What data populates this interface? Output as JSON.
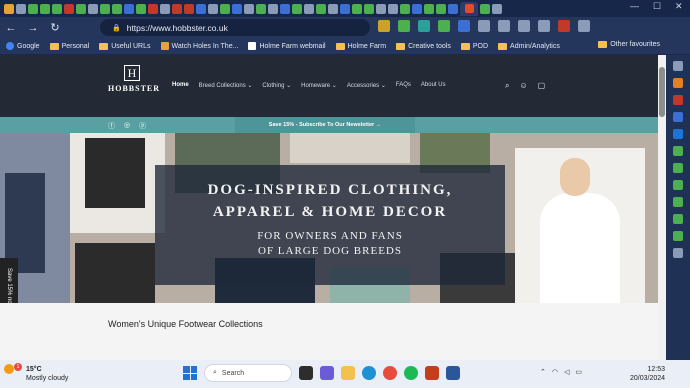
{
  "browser": {
    "url": "https://www.hobbster.co.uk",
    "bookmarks": [
      "Google",
      "Personal",
      "Useful URLs",
      "Watch Holes In The...",
      "Holme Farm webmail",
      "Holme Farm",
      "Creative tools",
      "POD",
      "Admin/Analytics"
    ],
    "other_favourites": "Other favourites",
    "window_controls": {
      "minimize": "—",
      "maximize": "☐",
      "close": "✕"
    }
  },
  "site": {
    "logo_mono": "H",
    "logo_word": "HOBBSTER",
    "nav": [
      "Home",
      "Breed Collections ⌄",
      "Clothing ⌄",
      "Homeware ⌄",
      "Accessories ⌄",
      "FAQs",
      "About Us"
    ],
    "announcement": "Save 15% - Subscribe To Our Newsletter →",
    "side_tab": "Save 15% now",
    "hero_title_line1": "DOG-INSPIRED CLOTHING,",
    "hero_title_line2": "APPAREL & HOME DECOR",
    "hero_sub_line1": "FOR OWNERS AND FANS",
    "hero_sub_line2": "OF LARGE DOG BREEDS",
    "section_title": "Women's Unique Footwear Collections"
  },
  "taskbar": {
    "temp": "15°C",
    "weather": "Mostly cloudy",
    "weather_badge": "1",
    "search": "Search",
    "time": "12:53",
    "date": "20/03/2024"
  }
}
